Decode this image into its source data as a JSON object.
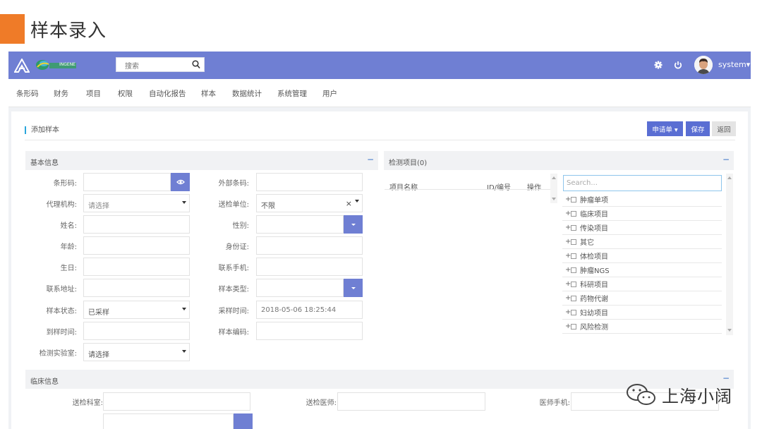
{
  "slide": {
    "title": "样本录入"
  },
  "topbar": {
    "logo_text": "INGENE",
    "search_placeholder": "搜索",
    "user": "system▾"
  },
  "nav": [
    "条形码",
    "财务",
    "项目",
    "权限",
    "自动化报告",
    "样本",
    "数据统计",
    "系统管理",
    "用户"
  ],
  "card": {
    "title": "添加样本",
    "buttons": {
      "apply": "申请单 ▾",
      "save": "保存",
      "back": "返回"
    }
  },
  "basic": {
    "title": "基本信息",
    "collapse": "−",
    "barcode": "条形码:",
    "agency": "代理机构:",
    "agency_placeholder": "请选择",
    "name": "姓名:",
    "age": "年龄:",
    "birthday": "生日:",
    "address": "联系地址:",
    "status": "样本状态:",
    "status_value": "已采样",
    "arrival": "到样时间:",
    "lab": "检测实验室:",
    "lab_value": "请选择",
    "ext_barcode": "外部条码:",
    "unit": "送检单位:",
    "unit_value": "不限",
    "unit_clear": "×",
    "gender": "性别:",
    "id_card": "身份证:",
    "phone": "联系手机:",
    "sample_type": "样本类型:",
    "sample_time": "采样时间:",
    "sample_time_value": "2018-05-06 18:25:44",
    "sample_code": "样本编码:"
  },
  "projects": {
    "title": "检测项目(0)",
    "collapse": "−",
    "col_name": "项目名称",
    "col_id": "ID/编号",
    "col_op": "操作",
    "search_placeholder": "Search...",
    "tree": [
      "肿瘤单项",
      "临床项目",
      "传染项目",
      "其它",
      "体检项目",
      "肿瘤NGS",
      "科研项目",
      "药物代谢",
      "妇幼项目",
      "风险检测"
    ]
  },
  "clinical": {
    "title": "临床信息",
    "collapse": "−",
    "dept": "送检科室:",
    "doctor": "送检医师:",
    "doctor_phone": "医师手机:"
  },
  "watermark": {
    "text": "上海小阔"
  }
}
